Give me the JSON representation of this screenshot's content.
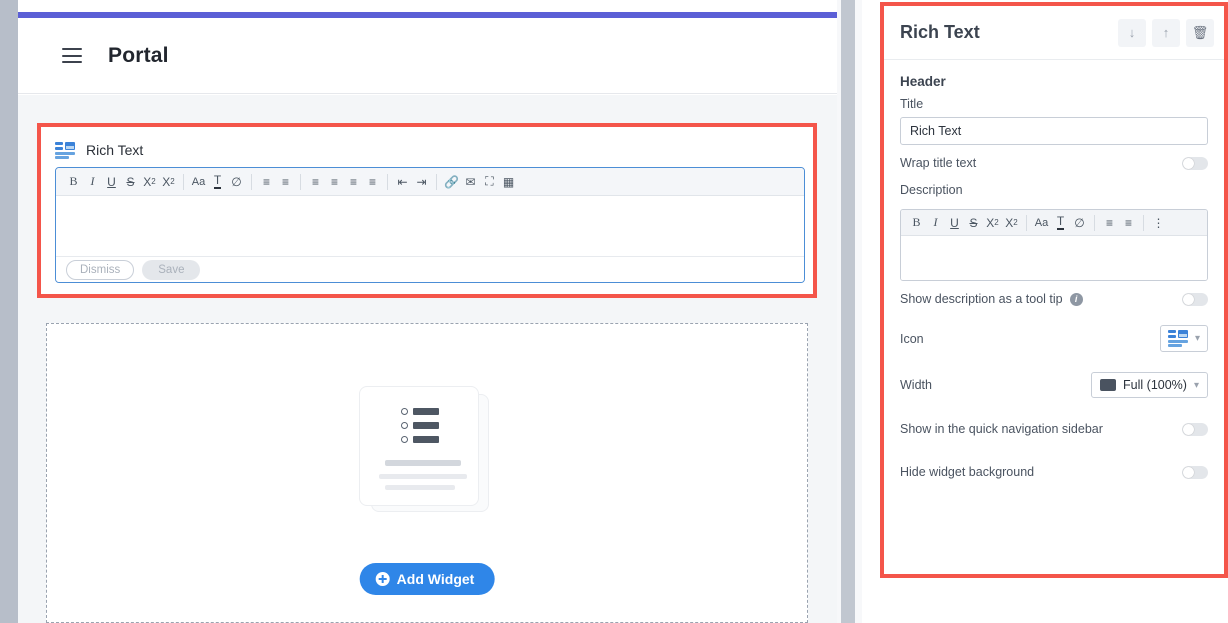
{
  "colors": {
    "accent_bar": "#5b5fd6",
    "annotation_red": "#f4554a",
    "primary_blue": "#2f86e8",
    "editor_focus_border": "#4c8ed6",
    "rich_text_icon": "#3b82d8"
  },
  "portal": {
    "menu_icon": "hamburger-menu-icon",
    "title": "Portal",
    "widget": {
      "icon": "rich-text-icon",
      "label": "Rich Text",
      "toolbar": [
        {
          "name": "bold",
          "glyph": "B"
        },
        {
          "name": "italic",
          "glyph": "I"
        },
        {
          "name": "underline",
          "glyph": "U"
        },
        {
          "name": "strikethrough",
          "glyph": "S"
        },
        {
          "name": "superscript",
          "glyph": "X"
        },
        {
          "name": "subscript",
          "glyph": "X"
        },
        {
          "name": "font-size",
          "glyph": "Aa"
        },
        {
          "name": "text-color",
          "glyph": "T"
        },
        {
          "name": "clear-format",
          "glyph": "⌀"
        },
        {
          "name": "bullet-list",
          "glyph": "☰"
        },
        {
          "name": "numbered-list",
          "glyph": "☰"
        },
        {
          "name": "align-left",
          "glyph": "≡"
        },
        {
          "name": "align-center",
          "glyph": "≡"
        },
        {
          "name": "align-right",
          "glyph": "≡"
        },
        {
          "name": "align-justify",
          "glyph": "≡"
        },
        {
          "name": "outdent",
          "glyph": "⇤"
        },
        {
          "name": "indent",
          "glyph": "⇥"
        },
        {
          "name": "insert-link",
          "glyph": "⚭"
        },
        {
          "name": "insert-email",
          "glyph": "✉"
        },
        {
          "name": "insert-image",
          "glyph": "ὛC"
        },
        {
          "name": "insert-table",
          "glyph": "⊞"
        }
      ],
      "body_value": "",
      "dismiss_label": "Dismiss",
      "save_label": "Save"
    },
    "empty_state": {
      "illustration": "stacked-cards-list-illustration",
      "add_widget_label": "Add Widget",
      "add_widget_icon": "plus-circle-icon"
    }
  },
  "config_panel": {
    "title": "Rich Text",
    "actions": [
      {
        "name": "move-down-button",
        "glyph": "↓"
      },
      {
        "name": "move-up-button",
        "glyph": "↑"
      },
      {
        "name": "delete-button",
        "glyph": "🗑"
      }
    ],
    "section_header": "Header",
    "title_field": {
      "label": "Title",
      "value": "Rich Text",
      "placeholder": "Title"
    },
    "wrap_title": {
      "label": "Wrap title text",
      "state": "off"
    },
    "description": {
      "label": "Description",
      "value": "",
      "toolbar": [
        {
          "name": "bold",
          "glyph": "B"
        },
        {
          "name": "italic",
          "glyph": "I"
        },
        {
          "name": "underline",
          "glyph": "U"
        },
        {
          "name": "strikethrough",
          "glyph": "S"
        },
        {
          "name": "superscript",
          "glyph": "X"
        },
        {
          "name": "subscript",
          "glyph": "X"
        },
        {
          "name": "font-size",
          "glyph": "Aa"
        },
        {
          "name": "text-color",
          "glyph": "T"
        },
        {
          "name": "clear-format",
          "glyph": "⌀"
        },
        {
          "name": "bullet-list",
          "glyph": "☰"
        },
        {
          "name": "numbered-list",
          "glyph": "☰"
        },
        {
          "name": "more-options",
          "glyph": "⋮"
        }
      ]
    },
    "tooltip_row": {
      "label": "Show description as a tool tip",
      "info_icon": "info-icon",
      "state": "off"
    },
    "icon_row": {
      "label": "Icon",
      "value_icon": "rich-text-icon",
      "chevron": "⌄"
    },
    "width_row": {
      "label": "Width",
      "value": "Full (100%)",
      "value_icon": "monitor-icon",
      "chevron": "⌄"
    },
    "quick_nav_row": {
      "label": "Show in the quick navigation sidebar",
      "state": "off"
    },
    "hide_bg_row": {
      "label": "Hide widget background",
      "state": "off"
    }
  }
}
